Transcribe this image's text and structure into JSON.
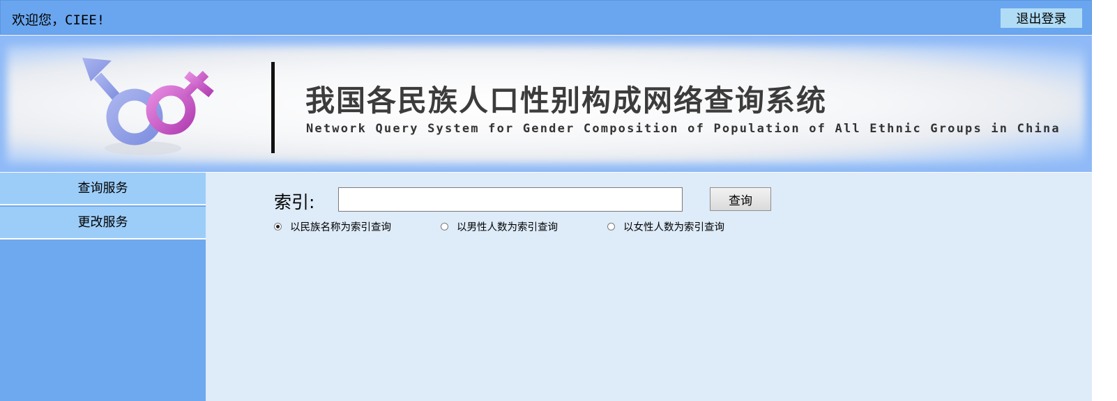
{
  "header": {
    "welcome_text": "欢迎您，CIEE!",
    "logout_label": "退出登录"
  },
  "banner": {
    "title_cn": "我国各民族人口性别构成网络查询系统",
    "title_en": "Network Query System for Gender Composition of Population of All Ethnic Groups in China",
    "logo_icon": "gender-symbols-icon"
  },
  "sidebar": {
    "items": [
      {
        "label": "查询服务"
      },
      {
        "label": "更改服务"
      }
    ]
  },
  "search": {
    "index_label": "索引:",
    "input_value": "",
    "button_label": "查询",
    "options": [
      {
        "label": "以民族名称为索引查询",
        "checked": true
      },
      {
        "label": "以男性人数为索引查询",
        "checked": false
      },
      {
        "label": "以女性人数为索引查询",
        "checked": false
      }
    ]
  },
  "colors": {
    "topbar": "#6aa6ef",
    "sidebar": "#6ea8ee",
    "sidebar_item": "#9ccdf9",
    "main_bg": "#deebf8",
    "banner_bg": "#8fbaf7"
  }
}
